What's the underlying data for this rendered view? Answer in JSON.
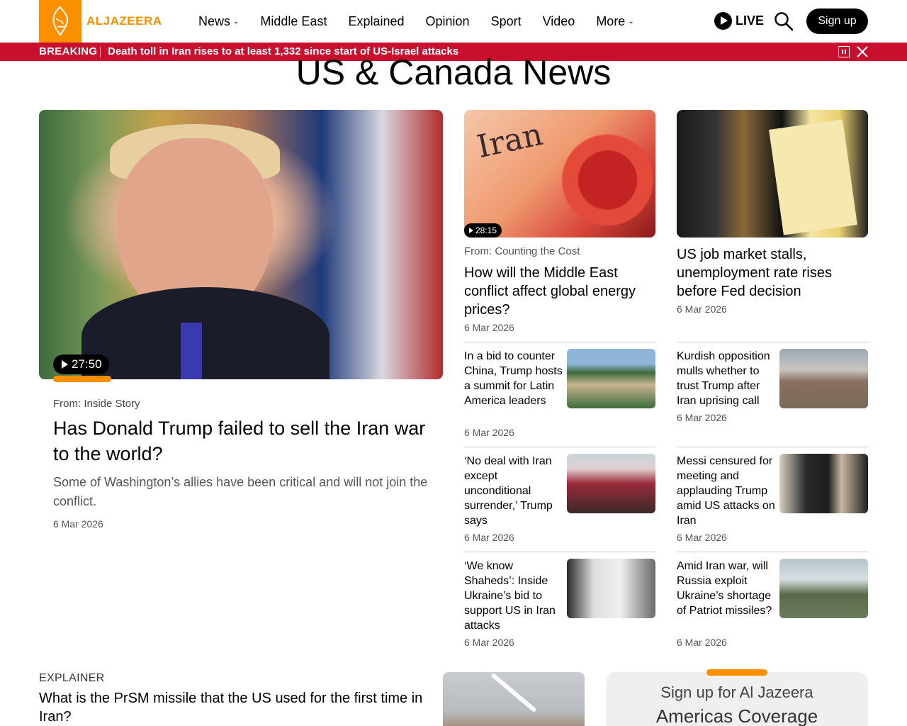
{
  "header": {
    "logo_text": "ALJAZEERA",
    "nav": [
      {
        "label": "News",
        "dropdown": true
      },
      {
        "label": "Middle East",
        "dropdown": false
      },
      {
        "label": "Explained",
        "dropdown": false
      },
      {
        "label": "Opinion",
        "dropdown": false
      },
      {
        "label": "Sport",
        "dropdown": false
      },
      {
        "label": "Video",
        "dropdown": false
      },
      {
        "label": "More",
        "dropdown": true
      }
    ],
    "live_label": "LIVE",
    "signup_label": "Sign up"
  },
  "breaking": {
    "label": "BREAKING",
    "text": "Death toll in Iran rises to at least 1,332 since start of US-Israel attacks"
  },
  "page_title": "US & Canada News",
  "feature": {
    "duration": "27:50",
    "from": "From: Inside Story",
    "title": "Has Donald Trump failed to sell the Iran war to the world?",
    "subtitle": "Some of Washington’s allies have been critical and will not join the conflict.",
    "date": "6 Mar 2026"
  },
  "col1_top": {
    "duration": "28:15",
    "from": "From: Counting the Cost",
    "title": "How will the Middle East conflict affect global energy prices?",
    "date": "6 Mar 2026",
    "image_word": "Iran"
  },
  "col2_top": {
    "title": "US job market stalls, unemployment rate rises before Fed decision",
    "date": "6 Mar 2026"
  },
  "list_left": [
    {
      "title": "In a bid to counter China, Trump hosts a summit for Latin America leaders",
      "date": "6 Mar 2026"
    },
    {
      "title": "‘No deal with Iran except unconditional surrender,’ Trump says",
      "date": "6 Mar 2026"
    },
    {
      "title": "‘We know Shaheds’: Inside Ukraine’s bid to support US in Iran attacks",
      "date": "6 Mar 2026"
    }
  ],
  "list_right": [
    {
      "title": "Kurdish opposition mulls whether to trust Trump after Iran uprising call",
      "date": "6 Mar 2026"
    },
    {
      "title": "Messi censured for meeting and applauding Trump amid US attacks on Iran",
      "date": "6 Mar 2026"
    },
    {
      "title": "Amid Iran war, will Russia exploit Ukraine’s shortage of Patriot missiles?",
      "date": "6 Mar 2026"
    }
  ],
  "explainer": {
    "label": "EXPLAINER",
    "title": "What is the PrSM missile that the US used for the first time in Iran?"
  },
  "signup_box": {
    "line1": "Sign up for Al Jazeera",
    "line2": "Americas Coverage"
  },
  "colors": {
    "brand_orange": "#fa9000",
    "breaking_red": "#c8102e"
  }
}
